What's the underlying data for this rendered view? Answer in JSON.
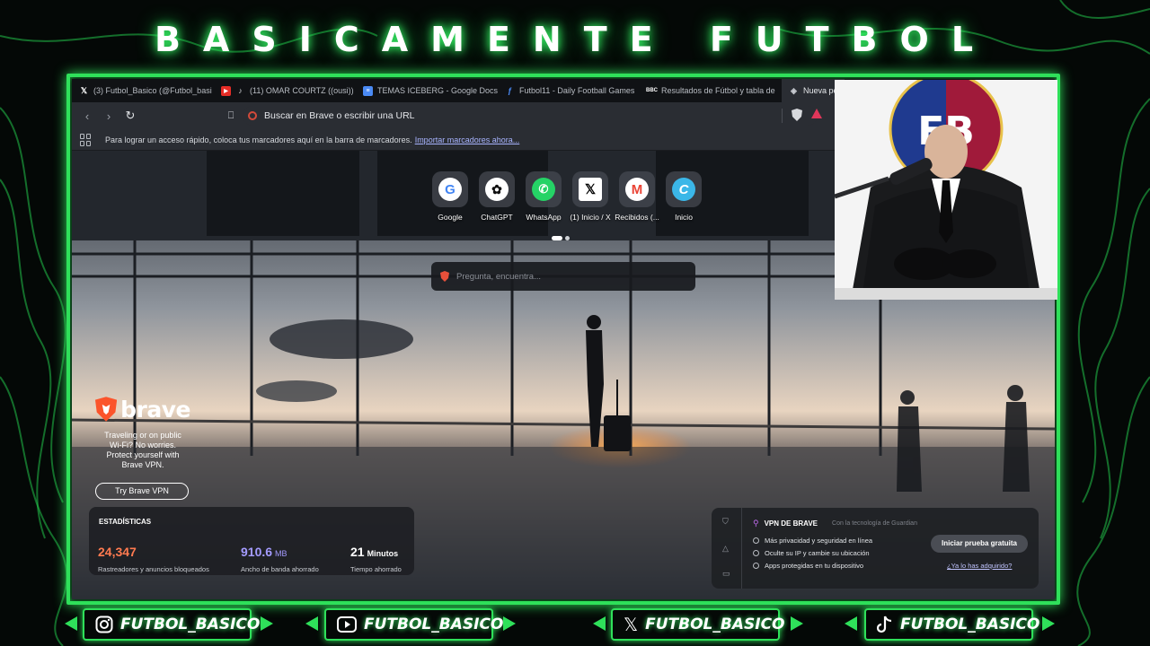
{
  "overlay": {
    "banner_title": "BASICAMENTE FUTBOL",
    "accent_color": "#2fe05a",
    "socials": [
      {
        "icon": "instagram-icon",
        "handle": "FUTBOL_BASICO"
      },
      {
        "icon": "youtube-icon",
        "handle": "FUTBOL_BASICO"
      },
      {
        "icon": "x-icon",
        "handle": "FUTBOL_BASICO"
      },
      {
        "icon": "tiktok-icon",
        "handle": "FUTBOL_BASICO"
      }
    ],
    "webcam_logo_text": "FB"
  },
  "browser": {
    "tabs": [
      {
        "icon": "x-icon",
        "title": "(3) Futbol_Basico (@Futbol_basi"
      },
      {
        "icon": "youtube-icon",
        "title": "(11) OMAR COURTZ ((ousi))"
      },
      {
        "icon": "google-docs-icon",
        "title": "TEMAS ICEBERG - Google Docs"
      },
      {
        "icon": "futbol11-icon",
        "title": "Futbol11 - Daily Football Games"
      },
      {
        "icon": "bbc-icon",
        "title": "Resultados de Fútbol y tabla de"
      },
      {
        "icon": "brave-icon",
        "title": "Nueva pe"
      }
    ],
    "address_placeholder": "Buscar en Brave o escribir una URL",
    "bookmarks_bar": {
      "message": "Para lograr un acceso rápido, coloca tus marcadores aquí en la barra de marcadores.",
      "import_link": "Importar marcadores ahora..."
    }
  },
  "new_tab": {
    "shortcuts": [
      {
        "label": "Google",
        "icon": "google-icon"
      },
      {
        "label": "ChatGPT",
        "icon": "chatgpt-icon"
      },
      {
        "label": "WhatsApp",
        "icon": "whatsapp-icon"
      },
      {
        "label": "(1) Inicio / X",
        "icon": "x-icon"
      },
      {
        "label": "Recibidos (...",
        "icon": "gmail-icon"
      },
      {
        "label": "Inicio",
        "icon": "canva-icon"
      }
    ],
    "search_placeholder": "Pregunta, encuentra...",
    "brave_promo": {
      "wordmark": "brave",
      "message": "Traveling or on public\nWi-Fi? No worries.\nProtect yourself with\nBrave VPN.",
      "button": "Try Brave VPN"
    },
    "stats": {
      "title": "ESTADÍSTICAS",
      "items": [
        {
          "value": "24,347",
          "unit": "",
          "label": "Rastreadores y anuncios bloqueados",
          "color": "#ff7a50"
        },
        {
          "value": "910.6",
          "unit": "MB",
          "label": "Ancho de banda ahorrado",
          "color": "#a49bff"
        },
        {
          "value": "21",
          "unit": "Minutos",
          "label": "Tiempo ahorrado",
          "color": "#ffffff"
        }
      ]
    },
    "vpn_card": {
      "title": "VPN DE BRAVE",
      "powered_by": "Con la tecnología de  Guardian",
      "features": [
        "Más privacidad y seguridad en línea",
        "Oculte su IP y cambie su ubicación",
        "Apps protegidas en tu dispositivo"
      ],
      "trial_button": "Iniciar prueba gratuita",
      "already_link": "¿Ya lo has adquirido?"
    }
  }
}
